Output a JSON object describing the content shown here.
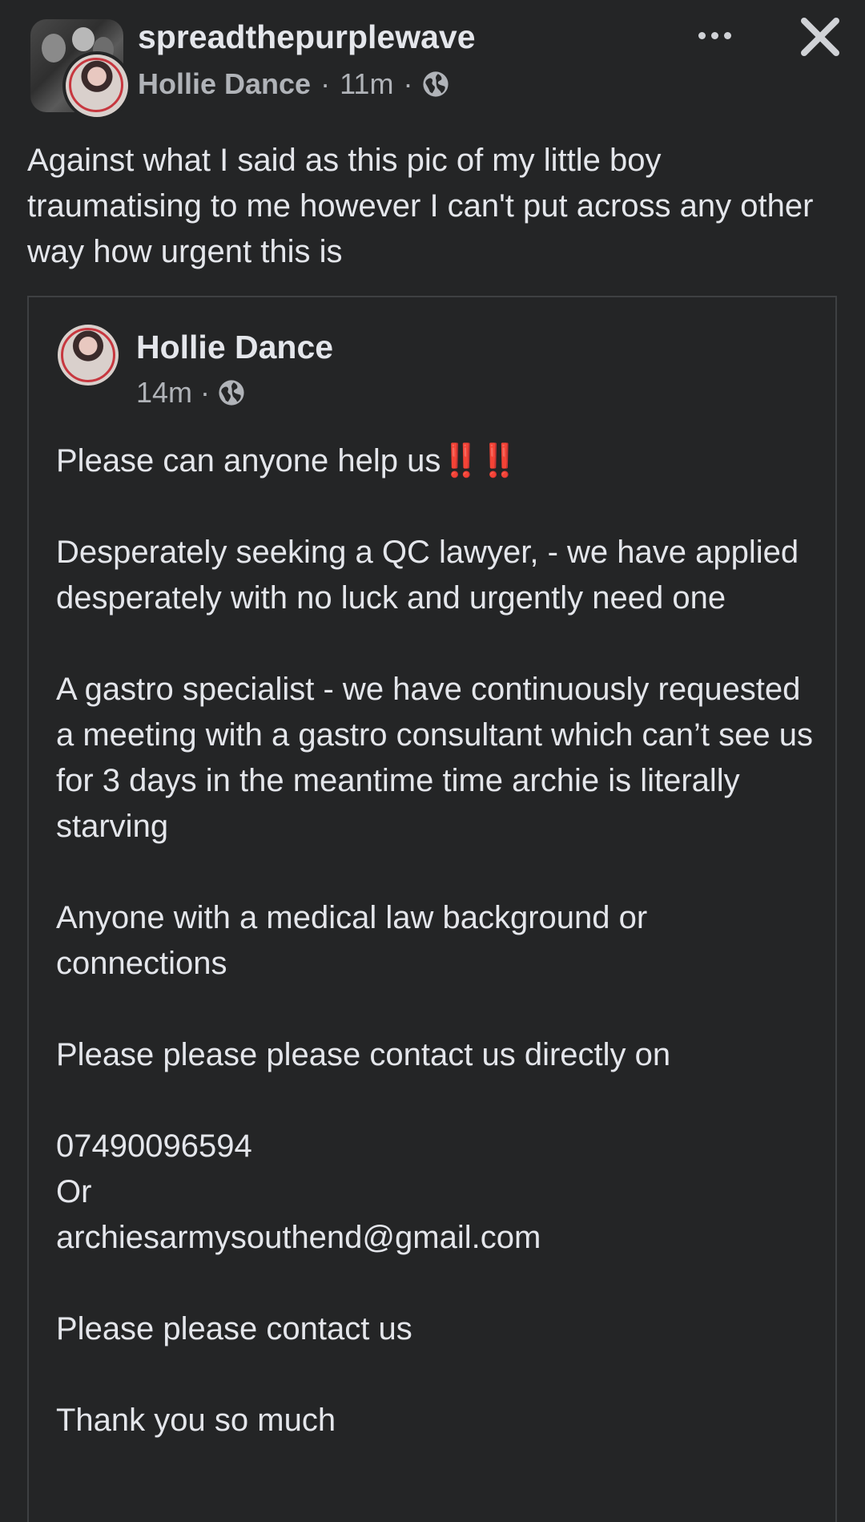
{
  "header": {
    "group_name": "spreadthepurplewave",
    "author": "Hollie Dance",
    "time": "11m",
    "separator": "·",
    "privacy_icon": "globe-icon",
    "more_icon": "more-options-icon",
    "close_icon": "close-icon"
  },
  "post": {
    "text": "Against what I said as this pic of my little boy traumatising to me however I can't put across any other way how urgent this is"
  },
  "shared_post": {
    "author": "Hollie Dance",
    "time": "14m",
    "separator": "·",
    "privacy_icon": "globe-icon",
    "paragraphs": {
      "p1": "Please can anyone help us",
      "p1_emoji": "‼️‼️",
      "p2": "Desperately seeking a QC lawyer, - we have applied desperately with no luck and urgently need one",
      "p3": "A gastro specialist - we have continuously requested a meeting with a gastro consultant which can’t see us for 3 days in the meantime time archie is literally starving",
      "p4": "Anyone with a medical law background or connections",
      "p5": "Please please please contact us directly on",
      "phone": "07490096594",
      "or": "Or",
      "email": "archiesarmysouthend@gmail.com",
      "p6": "Please please contact us",
      "p7": "Thank you so much"
    }
  },
  "colors": {
    "background": "#242526",
    "text_primary": "#e4e6eb",
    "text_secondary": "#b0b3b8",
    "border": "#3e4042",
    "emoji_red": "#e02424"
  }
}
